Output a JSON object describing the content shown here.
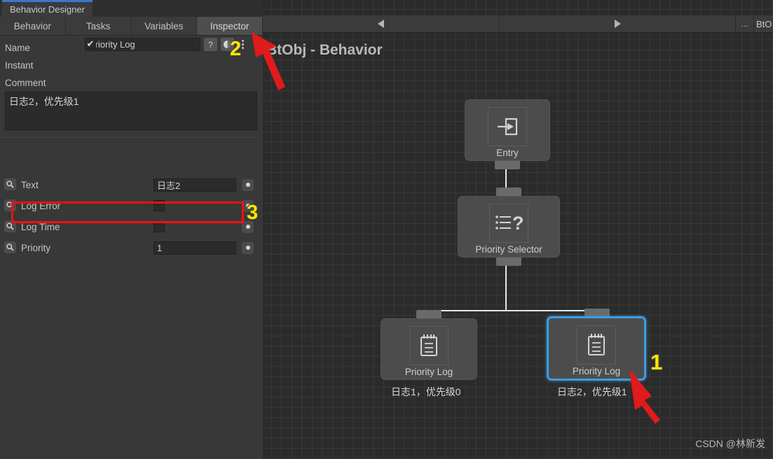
{
  "window": {
    "tab_title": "Behavior Designer",
    "accent_color": "#3a78c8"
  },
  "section_tabs": [
    {
      "label": "Behavior",
      "active": false
    },
    {
      "label": "Tasks",
      "active": false
    },
    {
      "label": "Variables",
      "active": false
    },
    {
      "label": "Inspector",
      "active": true
    }
  ],
  "inspector": {
    "name_label": "Name",
    "name_value": "Priority Log",
    "help_icon": "?",
    "preset_icon": "preset-circle-icon",
    "menu_icon": "kebab-menu-icon",
    "instant_label": "Instant",
    "instant_checked": true,
    "instant_check_glyph": "✔",
    "comment_label": "Comment",
    "comment_value": "日志2，优先级1",
    "properties": [
      {
        "name": "Text",
        "type": "text",
        "value": "日志2",
        "icon": "search-icon",
        "toggle": "radio-dot-icon"
      },
      {
        "name": "Log Error",
        "type": "checkbox",
        "value": "",
        "icon": "search-icon",
        "toggle": "radio-dot-icon"
      },
      {
        "name": "Log Time",
        "type": "checkbox",
        "value": "",
        "icon": "search-icon",
        "toggle": "radio-dot-icon"
      },
      {
        "name": "Priority",
        "type": "text",
        "value": "1",
        "icon": "search-icon",
        "toggle": "radio-dot-icon"
      }
    ]
  },
  "graph": {
    "toolbar": {
      "prev_icon": "triangle-left-icon",
      "next_icon": "triangle-right-icon",
      "overflow_label": "...",
      "object_label": "BtO"
    },
    "title": "BtObj - Behavior",
    "nodes": [
      {
        "id": "entry",
        "label": "Entry",
        "icon": "entry-arrow-icon",
        "comment": "",
        "selected": false
      },
      {
        "id": "selector",
        "label": "Priority Selector",
        "icon": "priority-selector-icon",
        "comment": "",
        "selected": false
      },
      {
        "id": "log0",
        "label": "Priority Log",
        "icon": "log-notepad-icon",
        "comment": "日志1，优先级0",
        "selected": false
      },
      {
        "id": "log1",
        "label": "Priority Log",
        "icon": "log-notepad-icon",
        "comment": "日志2，优先级1",
        "selected": true
      }
    ],
    "selection_color": "#3d9de0",
    "connection_color": "#e8e8e8"
  },
  "annotations": {
    "marker_1": "1",
    "marker_2": "2",
    "marker_3": "3",
    "marker_color": "#ffe600",
    "highlight_color": "#ee1111"
  },
  "watermark": "CSDN @林新发"
}
